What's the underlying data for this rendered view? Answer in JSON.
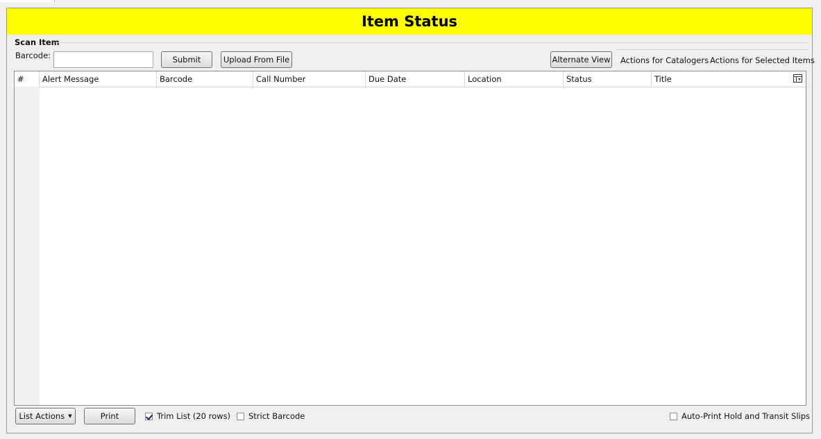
{
  "page": {
    "title": "Item Status"
  },
  "scan": {
    "section_label": "Scan Item",
    "barcode_label": "Barcode:",
    "barcode_value": "",
    "submit_label": "Submit",
    "upload_label": "Upload From File",
    "alternate_view_label": "Alternate View"
  },
  "menus": {
    "catalogers": "Actions for Catalogers",
    "selected_items": "Actions for Selected Items"
  },
  "grid": {
    "columns": [
      "#",
      "Alert Message",
      "Barcode",
      "Call Number",
      "Due Date",
      "Location",
      "Status",
      "Title"
    ],
    "rows": []
  },
  "footer": {
    "list_actions_label": "List Actions",
    "print_label": "Print",
    "trim_list_label": "Trim List (20 rows)",
    "trim_list_checked": true,
    "strict_barcode_label": "Strict Barcode",
    "strict_barcode_checked": false,
    "auto_print_label": "Auto-Print Hold and Transit Slips",
    "auto_print_checked": false
  },
  "colors": {
    "banner": "#ffff00",
    "background": "#f0f0f0"
  },
  "icons": {
    "column_picker": "column-picker-icon",
    "dropdown": "dropdown-arrow-icon"
  }
}
